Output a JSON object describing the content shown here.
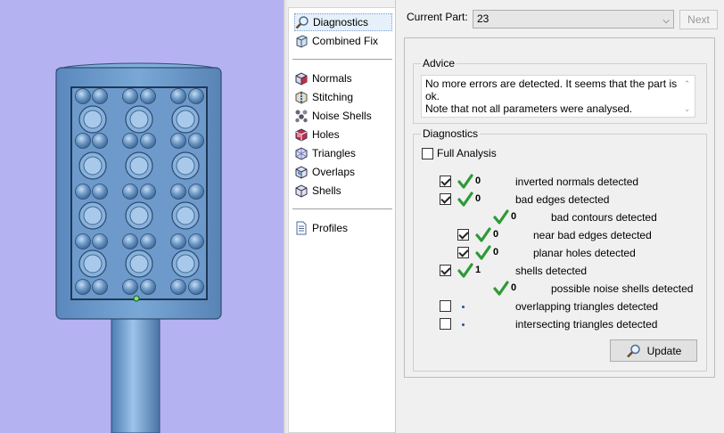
{
  "nav": {
    "items": [
      {
        "label": "Diagnostics",
        "icon": "magnifier-icon"
      },
      {
        "label": "Combined Fix",
        "icon": "cube-icon"
      },
      {
        "label": "Normals",
        "icon": "cube-red-icon"
      },
      {
        "label": "Stitching",
        "icon": "stitching-icon"
      },
      {
        "label": "Noise Shells",
        "icon": "noise-shells-icon"
      },
      {
        "label": "Holes",
        "icon": "holes-icon"
      },
      {
        "label": "Triangles",
        "icon": "triangles-icon"
      },
      {
        "label": "Overlaps",
        "icon": "overlaps-icon"
      },
      {
        "label": "Shells",
        "icon": "shells-icon"
      },
      {
        "label": "Profiles",
        "icon": "document-icon"
      }
    ]
  },
  "part": {
    "label": "Current Part:",
    "value": "23",
    "next_label": "Next"
  },
  "advice": {
    "title": "Advice",
    "line1": "No more errors are detected. It seems that the part is ok.",
    "line2": "Note that not all parameters were analysed."
  },
  "diagnostics": {
    "title": "Diagnostics",
    "full_analysis_label": "Full Analysis",
    "full_analysis_checked": false,
    "rows": [
      {
        "checked": true,
        "status": "ok",
        "count": "0",
        "label": "inverted normals detected"
      },
      {
        "checked": true,
        "status": "ok",
        "count": "0",
        "label": "bad edges detected"
      },
      {
        "checked": null,
        "status": "ok",
        "count": "0",
        "label": "bad contours detected"
      },
      {
        "checked": true,
        "status": "ok",
        "count": "0",
        "label": "near bad edges detected"
      },
      {
        "checked": true,
        "status": "ok",
        "count": "0",
        "label": "planar holes detected"
      },
      {
        "checked": true,
        "status": "ok",
        "count": "1",
        "label": "shells detected"
      },
      {
        "checked": null,
        "status": "ok",
        "count": "0",
        "label": "possible noise shells detected"
      },
      {
        "checked": false,
        "status": "pending",
        "count": "",
        "label": "overlapping triangles detected"
      },
      {
        "checked": false,
        "status": "pending",
        "count": "",
        "label": "intersecting triangles detected"
      }
    ],
    "update_label": "Update"
  },
  "colors": {
    "viewport_bg": "#b5b2f2",
    "model_blue": "#6f9fcf",
    "check_green": "#2e9a35",
    "dot_blue": "#1f4fa8"
  }
}
